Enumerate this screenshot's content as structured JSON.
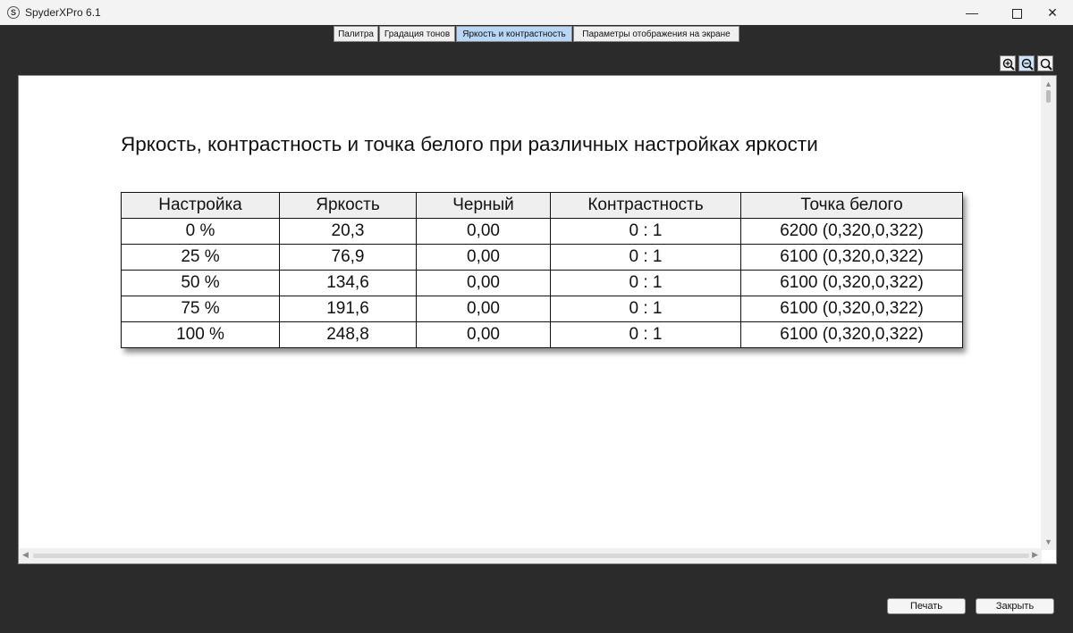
{
  "window": {
    "title": "SpyderXPro 6.1",
    "icon_letter": "S",
    "minimize": "—",
    "close": "✕"
  },
  "tabs": [
    {
      "label": "Палитра",
      "active": false
    },
    {
      "label": "Градация тонов",
      "active": false
    },
    {
      "label": "Яркость и контрастность",
      "active": true
    },
    {
      "label": "Параметры отображения на экране",
      "active": false
    }
  ],
  "zoom": {
    "buttons": [
      "zoom-in-icon",
      "zoom-out-icon",
      "zoom-fit-icon"
    ]
  },
  "report": {
    "title": "Яркость, контрастность и точка белого при различных настройках яркости",
    "columns": [
      "Настройка",
      "Яркость",
      "Черный",
      "Контрастность",
      "Точка белого"
    ],
    "rows": [
      [
        "0 %",
        "20,3",
        "0,00",
        "0 : 1",
        "6200 (0,320,0,322)"
      ],
      [
        "25 %",
        "76,9",
        "0,00",
        "0 : 1",
        "6100 (0,320,0,322)"
      ],
      [
        "50 %",
        "134,6",
        "0,00",
        "0 : 1",
        "6100 (0,320,0,322)"
      ],
      [
        "75 %",
        "191,6",
        "0,00",
        "0 : 1",
        "6100 (0,320,0,322)"
      ],
      [
        "100 %",
        "248,8",
        "0,00",
        "0 : 1",
        "6100 (0,320,0,322)"
      ]
    ]
  },
  "footer": {
    "print_label": "Печать",
    "close_label": "Закрыть"
  }
}
